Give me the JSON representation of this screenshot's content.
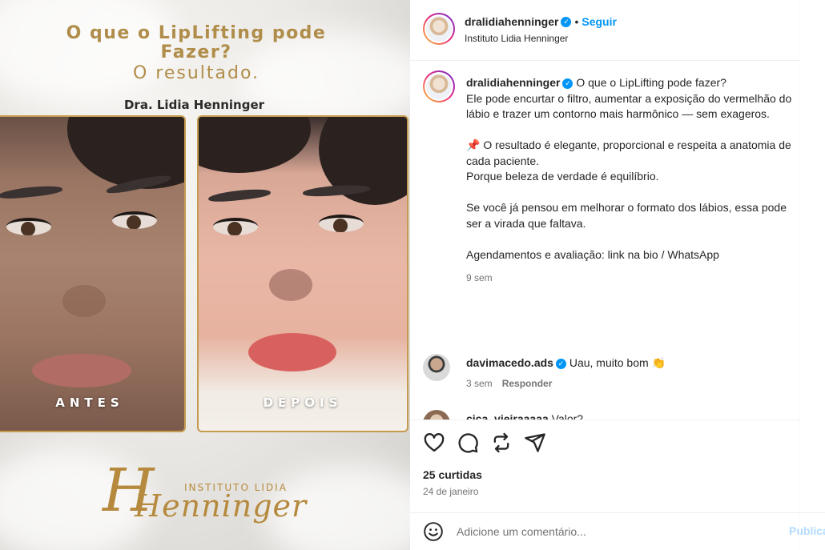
{
  "image": {
    "headline_line1": "O que o LipLifting pode",
    "headline_line2": "Fazer?",
    "headline_line3": "O resultado.",
    "doctor_name": "Dra. Lidia Henninger",
    "before_label": "ANTES",
    "after_label": "DEPOIS",
    "logo_small": "INSTITUTO LIDIA",
    "logo_script": "Henninger",
    "accent_color": "#b08d4a"
  },
  "header": {
    "username": "dralidiahenninger",
    "verified_icon": "verified-badge-icon",
    "separator": "•",
    "follow_label": "Seguir",
    "subtitle": "Instituto Lidia Henninger"
  },
  "caption": {
    "username": "dralidiahenninger",
    "text": "O que o LipLifting pode fazer?\nEle pode encurtar o filtro, aumentar a exposição do vermelhão do lábio e trazer um contorno mais harmônico — sem exageros.\n\n📌 O resultado é elegante, proporcional e respeita a anatomia de cada paciente.\nPorque beleza de verdade é equilíbrio.\n\nSe você já pensou em melhorar o formato dos lábios, essa pode ser a virada que faltava.\n\nAgendamentos e avaliação: link na bio / WhatsApp",
    "time": "9 sem"
  },
  "comments": [
    {
      "username": "davimacedo.ads",
      "text": "Uau, muito bom 👏",
      "time": "3 sem",
      "reply_label": "Responder"
    },
    {
      "username": "cica_vieiraaaaa",
      "text": "Valor?"
    }
  ],
  "actions": {
    "icons": [
      "heart-icon",
      "comment-icon",
      "repost-icon",
      "share-icon"
    ],
    "likes": "25 curtidas",
    "date": "24 de janeiro"
  },
  "comment_input": {
    "placeholder": "Adicione um comentário...",
    "emoji_icon": "emoji-icon",
    "publish_label": "Publicar"
  }
}
